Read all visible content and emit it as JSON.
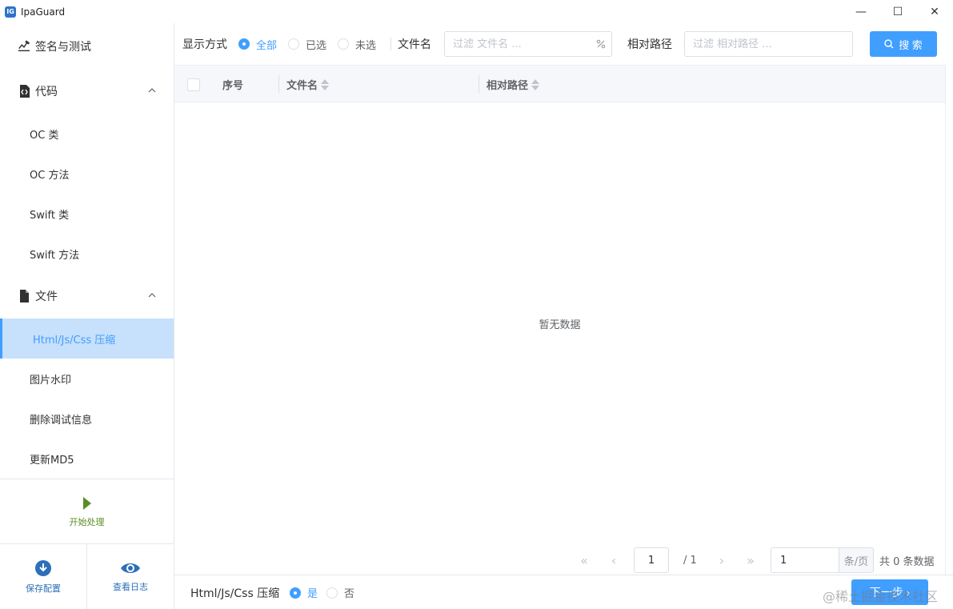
{
  "window": {
    "app_logo": "IG",
    "title": "IpaGuard",
    "minimize_glyph": "—",
    "maximize_glyph": "☐",
    "close_glyph": "✕"
  },
  "sidebar": {
    "sign_test": {
      "label": "签名与测试",
      "icon": "sign-edit-icon"
    },
    "code_group": {
      "label": "代码",
      "icon": "code-file-icon",
      "expanded": true
    },
    "code_items": [
      "OC 类",
      "OC 方法",
      "Swift 类",
      "Swift 方法"
    ],
    "file_group": {
      "label": "文件",
      "icon": "file-icon",
      "expanded": true
    },
    "file_items": [
      "Html/Js/Css 压缩",
      "图片水印",
      "删除调试信息",
      "更新MD5"
    ],
    "active_item": "Html/Js/Css 压缩",
    "start_label": "开始处理",
    "save_config_label": "保存配置",
    "view_log_label": "查看日志"
  },
  "filter": {
    "display_label": "显示方式",
    "options": [
      "全部",
      "已选",
      "未选"
    ],
    "selected_option": "全部",
    "filename_label": "文件名",
    "filename_placeholder": "过滤 文件名 ...",
    "path_label": "相对路径",
    "path_placeholder": "过滤 相对路径 ...",
    "search_label": "搜 索"
  },
  "table": {
    "columns": [
      "序号",
      "文件名",
      "相对路径"
    ],
    "rows": [],
    "empty_text": "暂无数据"
  },
  "pagination": {
    "current_page": "1",
    "total_pages": "/ 1",
    "page_size": "1",
    "page_size_unit": "条/页",
    "total_text": "共 0 条数据"
  },
  "footer": {
    "option_label": "Html/Js/Css 压缩",
    "yes_label": "是",
    "no_label": "否",
    "selected": "是",
    "next_label": "下一步 ›"
  },
  "watermark": "@稀土掘金技术社区",
  "colors": {
    "accent": "#409eff",
    "active_bg": "#c7e0fb",
    "start_green": "#5a8d26",
    "bottom_blue": "#2d6fb8"
  }
}
